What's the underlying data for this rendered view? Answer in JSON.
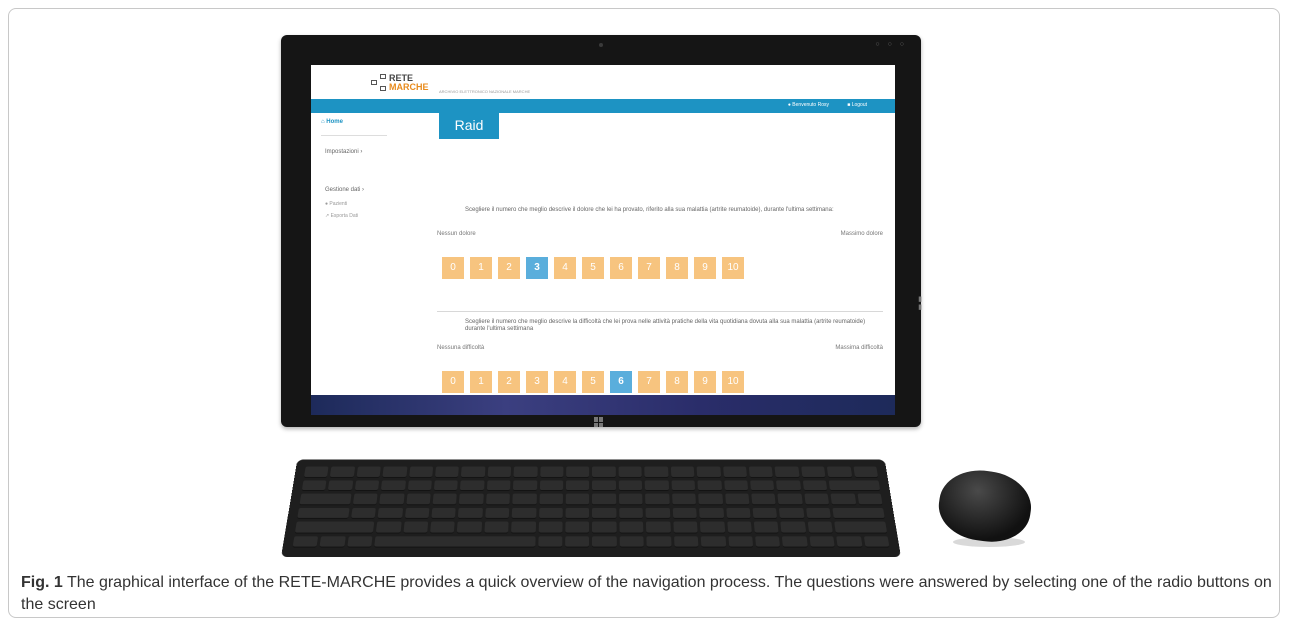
{
  "app": {
    "logo_line1": "RETE",
    "logo_line2": "MARCHE",
    "tagline": "ARCHIVIO ELETTRONICO NAZIONALE MARCHE",
    "user_label": "Benvenuto Rosy",
    "logout_label": "Logout"
  },
  "sidebar": {
    "home": "Home",
    "items": [
      {
        "label": "Impostazioni"
      },
      {
        "label": "Gestione dati"
      }
    ],
    "subitems": [
      {
        "label": "Pazienti"
      },
      {
        "label": "Esporta Dati"
      }
    ]
  },
  "page": {
    "title": "Raid"
  },
  "question1": {
    "text": "Scegliere il numero che meglio descrive il dolore che lei ha provato, riferito alla sua malattia (artrite reumatoide), durante l'ultima settimana:",
    "min_label": "Nessun dolore",
    "max_label": "Massimo dolore",
    "options": [
      "0",
      "1",
      "2",
      "3",
      "4",
      "5",
      "6",
      "7",
      "8",
      "9",
      "10"
    ],
    "selected": "3"
  },
  "question2": {
    "text": "Scegliere il numero che meglio descrive la difficoltà che lei prova nelle attività pratiche della vita quotidiana dovuta alla sua malattia (artrite reumatoide) durante l'ultima settimana",
    "min_label": "Nessuna difficoltà",
    "max_label": "Massima difficoltà",
    "options": [
      "0",
      "1",
      "2",
      "3",
      "4",
      "5",
      "6",
      "7",
      "8",
      "9",
      "10"
    ],
    "selected": "6"
  },
  "caption": {
    "label": "Fig. 1",
    "text": " The graphical interface of the RETE-MARCHE provides a quick overview of the navigation process. The questions were answered by selecting one of the radio buttons on the screen"
  },
  "icons": {
    "home": "home-icon",
    "user": "user-icon",
    "lock": "lock-icon",
    "arrow": "chevron-right-icon",
    "windows": "windows-logo-icon"
  },
  "colors": {
    "accent": "#1d93c3",
    "option": "#f7c47f",
    "selected": "#5aaedc"
  }
}
